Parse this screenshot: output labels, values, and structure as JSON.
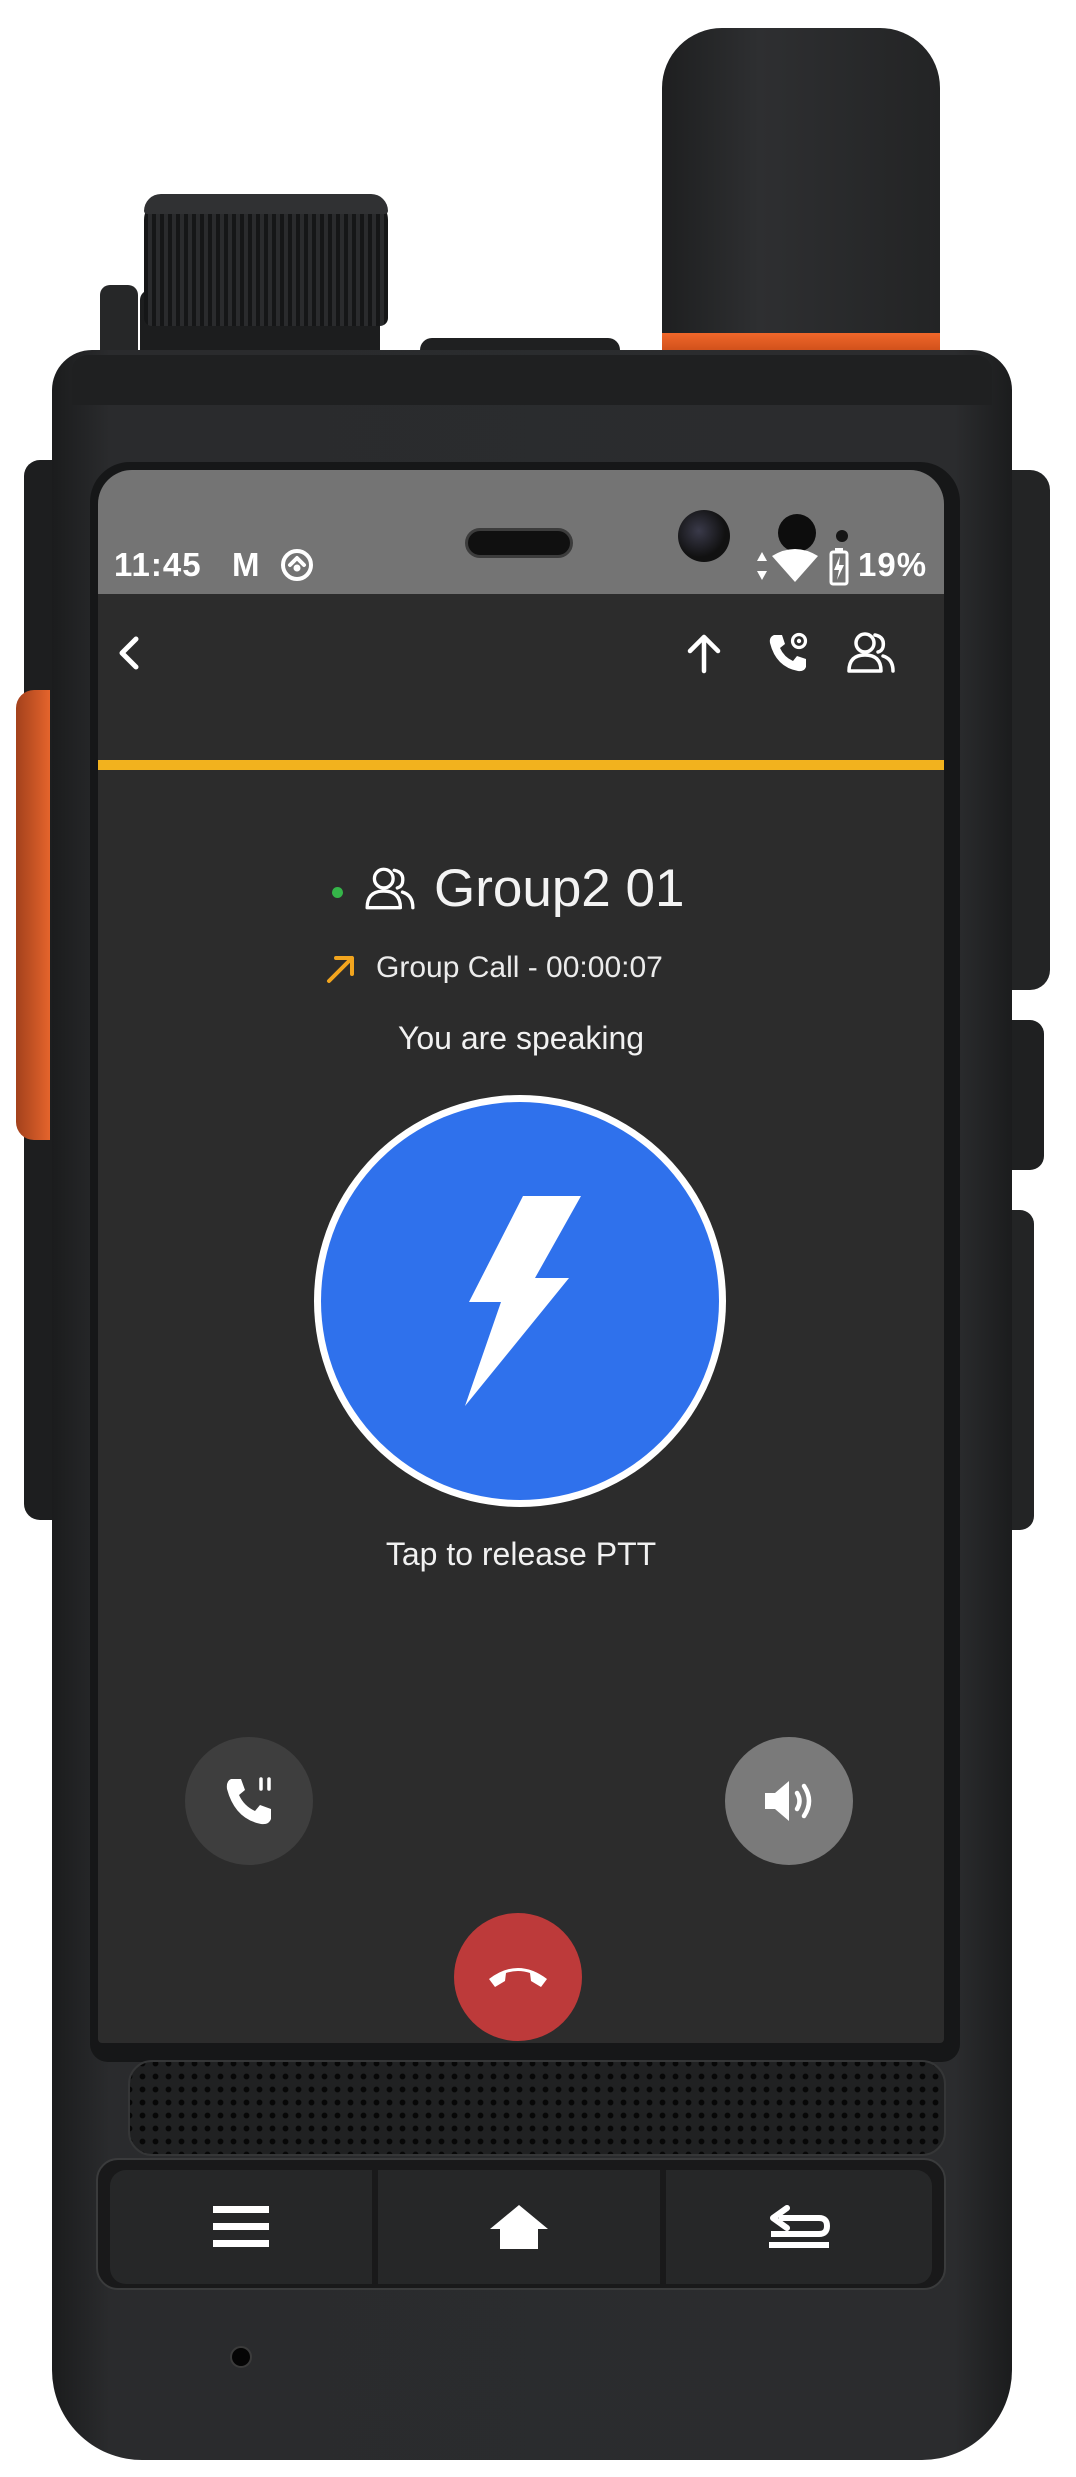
{
  "status_bar": {
    "time": "11:45",
    "mail_indicator": "M",
    "sync_icon": "sync-circle-icon",
    "signal_icons": "data-wifi-icon",
    "battery_icon": "battery-charging-icon",
    "battery_percent": "19%"
  },
  "toolbar": {
    "back_icon": "chevron-left-icon",
    "upload_icon": "arrow-up-icon",
    "call_settings_icon": "phone-settings-icon",
    "members_icon": "group-members-icon",
    "accent_color": "#f2b21e"
  },
  "call": {
    "online_status_color": "#35b549",
    "group_name": "Group2 01",
    "direction_icon": "outgoing-arrow-icon",
    "info": "Group Call - 00:00:07",
    "status": "You are speaking"
  },
  "ptt": {
    "icon": "lightning-bolt-icon",
    "color": "#2f71ec",
    "hint": "Tap to release PTT"
  },
  "controls": {
    "call_mode_icon": "phone-call-icon",
    "speaker_icon": "speaker-volume-icon",
    "hangup_icon": "hang-up-icon",
    "hangup_color": "#bd3a3a"
  },
  "hardware_keys": {
    "menu_icon": "menu-icon",
    "home_icon": "home-icon",
    "back_icon": "return-icon"
  }
}
